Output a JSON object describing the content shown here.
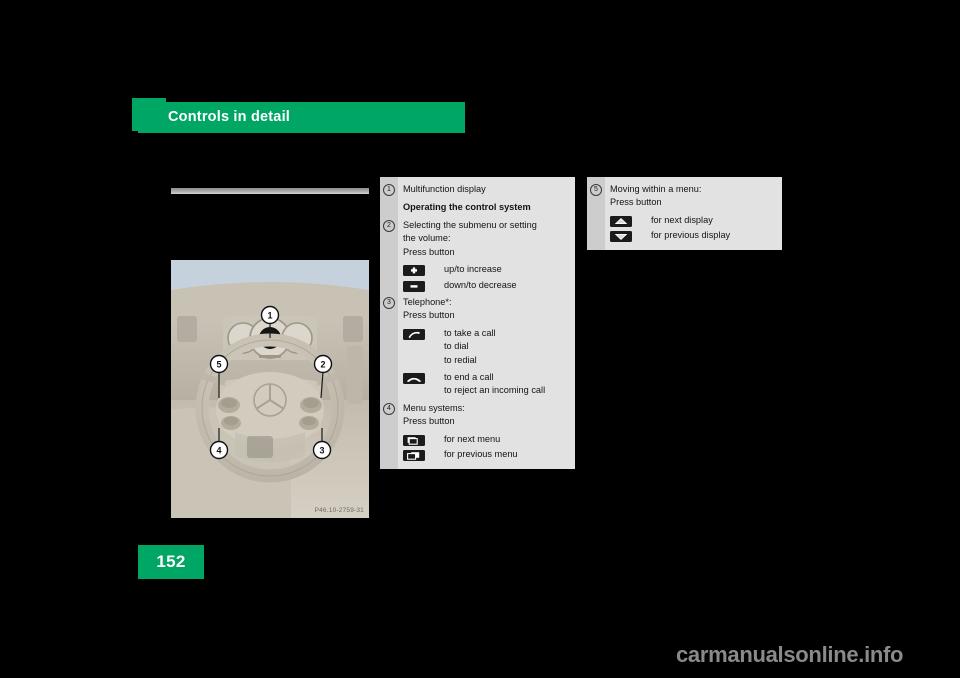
{
  "header": {
    "title": "Controls in detail"
  },
  "figure": {
    "code": "P46.10-2759-31",
    "callouts": [
      "1",
      "2",
      "3",
      "4",
      "5"
    ],
    "alt": "steering-wheel-multifunction-controls"
  },
  "page_number": "152",
  "watermark": "carmanualsonline.info",
  "left_box": {
    "items": [
      {
        "number": "1",
        "lines": [
          "Multifunction display"
        ],
        "bold": false,
        "icons": []
      },
      {
        "number": "",
        "lines": [
          "Operating the control system"
        ],
        "bold": true,
        "icons": []
      },
      {
        "number": "2",
        "lines": [
          "Selecting the submenu or setting",
          "the volume:",
          "Press button"
        ],
        "bold": false,
        "icons": [
          {
            "icon": "plus-button-icon",
            "lines": [
              "up/to increase"
            ]
          },
          {
            "icon": "minus-button-icon",
            "lines": [
              "down/to decrease"
            ]
          }
        ]
      },
      {
        "number": "3",
        "lines": [
          "Telephone*:",
          "Press button"
        ],
        "bold": false,
        "icons": [
          {
            "icon": "phone-take-call-icon",
            "lines": [
              "to take a call",
              "to dial",
              "to redial"
            ]
          },
          {
            "icon": "phone-end-call-icon",
            "lines": [
              "to end a call",
              "to reject an incoming call"
            ]
          }
        ]
      },
      {
        "number": "4",
        "lines": [
          "Menu systems:",
          "Press button"
        ],
        "bold": false,
        "icons": [
          {
            "icon": "next-menu-icon",
            "lines": [
              "for next menu"
            ]
          },
          {
            "icon": "previous-menu-icon",
            "lines": [
              "for previous menu"
            ]
          }
        ]
      }
    ]
  },
  "right_box": {
    "items": [
      {
        "number": "5",
        "lines": [
          "Moving within a menu:",
          "Press button"
        ],
        "bold": false,
        "icons": [
          {
            "icon": "arrow-up-button-icon",
            "lines": [
              "for next display"
            ]
          },
          {
            "icon": "arrow-down-button-icon",
            "lines": [
              "for previous display"
            ]
          }
        ]
      }
    ]
  },
  "colors": {
    "brand_green": "#00A663",
    "box_bg": "#e2e2e2",
    "num_col_bg": "#cdcdcd",
    "icon_dark": "#1b1b1b",
    "page_bg": "#000000"
  }
}
